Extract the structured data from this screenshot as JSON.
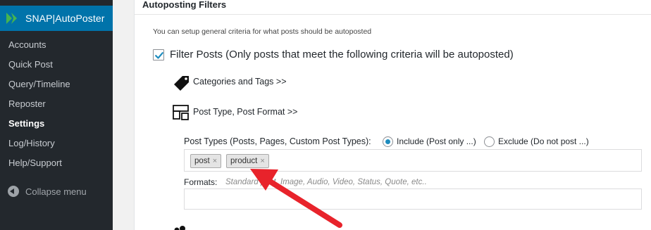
{
  "sidebar": {
    "title": "SNAP|AutoPoster",
    "items": [
      {
        "label": "Accounts",
        "active": false
      },
      {
        "label": "Quick Post",
        "active": false
      },
      {
        "label": "Query/Timeline",
        "active": false
      },
      {
        "label": "Reposter",
        "active": false
      },
      {
        "label": "Settings",
        "active": true
      },
      {
        "label": "Log/History",
        "active": false
      },
      {
        "label": "Help/Support",
        "active": false
      }
    ],
    "collapse_label": "Collapse menu"
  },
  "panel": {
    "title": "Autoposting Filters",
    "hint": "You can setup general criteria for what posts should be autoposted",
    "filter_posts": {
      "label": "Filter Posts (Only posts that meet the following criteria will be autoposted)",
      "checked": true
    },
    "categories_tags_label": "Categories and Tags  >>",
    "post_type_format_label": "Post Type, Post Format  >>",
    "post_types": {
      "label": "Post Types (Posts, Pages, Custom Post Types):",
      "include_label": "Include (Post only ...)",
      "exclude_label": "Exclude (Do not post ...)",
      "selected": "include",
      "tokens": [
        "post",
        "product"
      ],
      "token_remove_glyph": "×"
    },
    "formats": {
      "label": "Formats:",
      "placeholder": "Standard post, Image, Audio, Video, Status, Quote, etc.."
    }
  },
  "colors": {
    "sidebar_bg": "#23282d",
    "accent": "#0073aa",
    "logo_green": "#46b450",
    "annotation_arrow": "#e8232b"
  },
  "icons": [
    "snap-logo-icon",
    "checkmark-icon",
    "tag-icon",
    "post-type-icon",
    "radio-icon",
    "collapse-icon"
  ]
}
